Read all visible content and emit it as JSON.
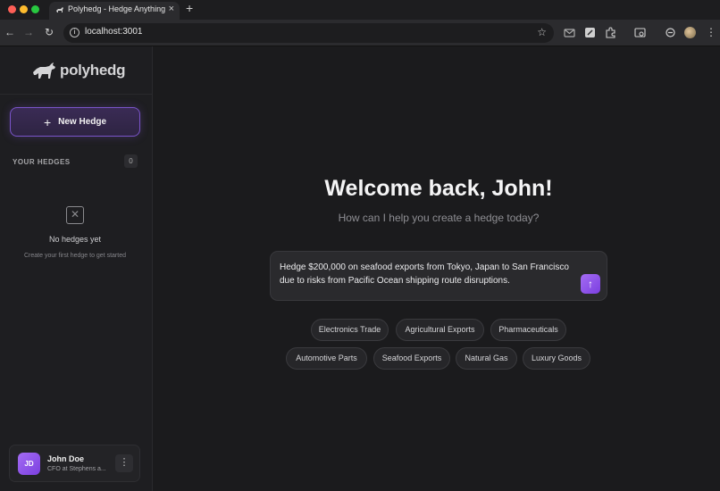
{
  "browser": {
    "tab_title": "Polyhedg - Hedge Anything",
    "tab_close": "×",
    "new_tab": "+",
    "url": "localhost:3001"
  },
  "sidebar": {
    "logo_text": "polyhedg",
    "new_hedge_label": "New Hedge",
    "section_title": "YOUR HEDGES",
    "hedge_count": "0",
    "empty_title": "No hedges yet",
    "empty_subtitle": "Create your first hedge to get started"
  },
  "user": {
    "initials": "JD",
    "name": "John Doe",
    "role": "CFO at Stephens a..."
  },
  "main": {
    "welcome": "Welcome back, John!",
    "subtitle": "How can I help you create a hedge today?",
    "prompt": "Hedge $200,000 on seafood exports from Tokyo, Japan to San Francisco due to risks from Pacific Ocean shipping route disruptions.",
    "chips_row1": [
      "Electronics Trade",
      "Agricultural Exports",
      "Pharmaceuticals"
    ],
    "chips_row2": [
      "Automotive Parts",
      "Seafood Exports",
      "Natural Gas",
      "Luxury Goods"
    ]
  },
  "colors": {
    "accent": "#8b5cf6",
    "background": "#1b1b1d",
    "sidebar": "#1e1e21"
  }
}
